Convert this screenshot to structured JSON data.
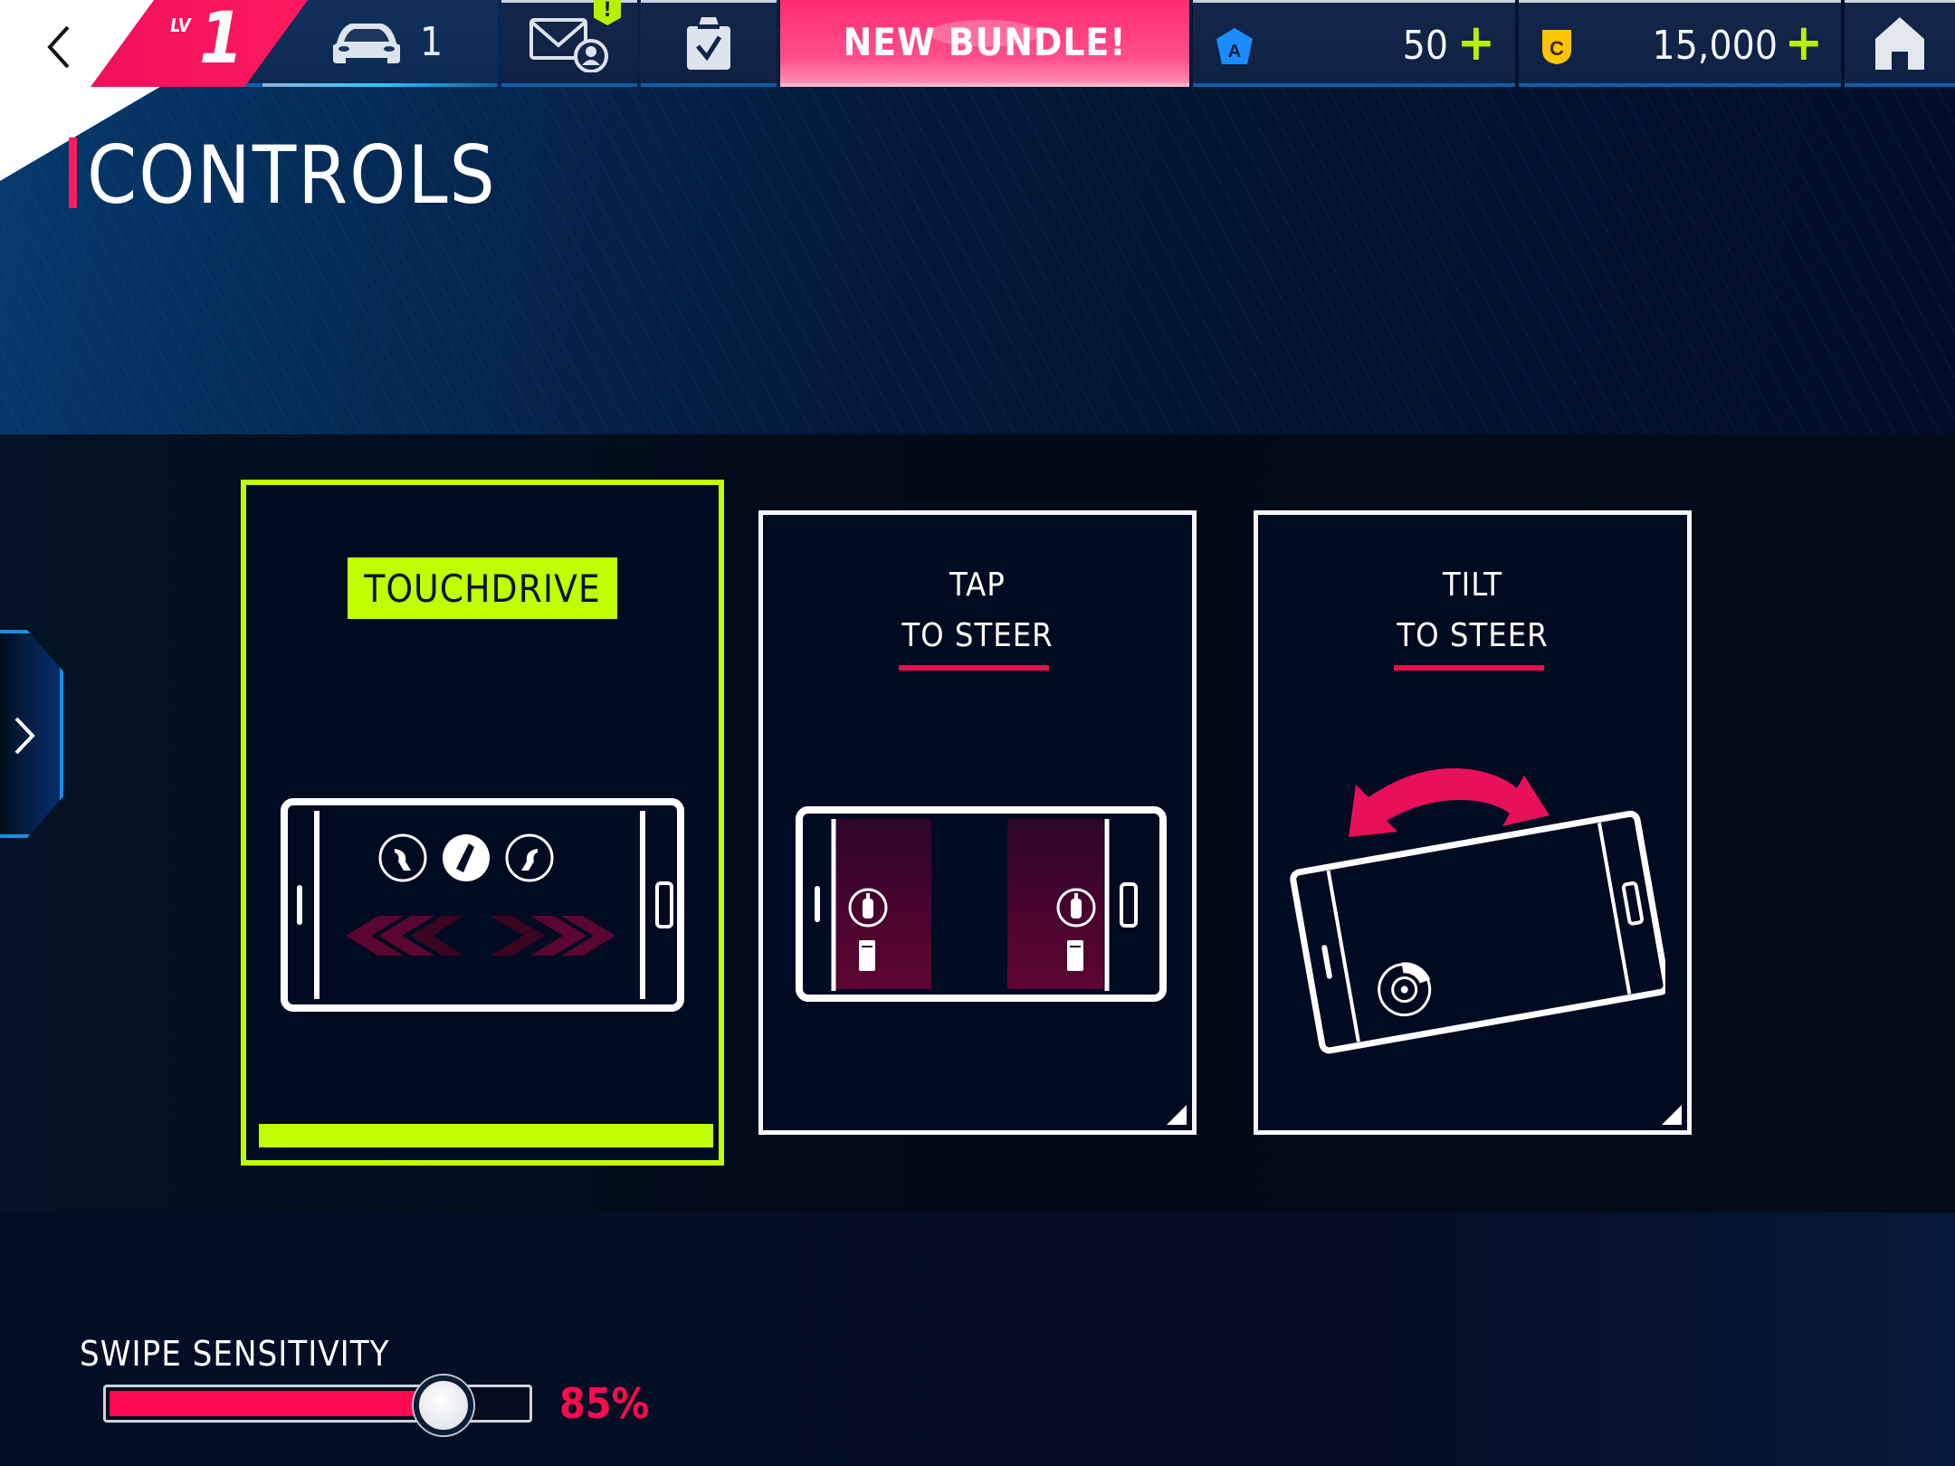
{
  "header": {
    "level_prefix": "LV",
    "level": "1",
    "garage_count": "1",
    "mail_notification": "!",
    "bundle_label": "NEW BUNDLE!",
    "tokens": "50",
    "credits": "15,000",
    "plus": "+"
  },
  "page": {
    "title": "CONTROLS"
  },
  "control_modes": [
    {
      "id": "touchdrive",
      "label": "TOUCHDRIVE",
      "selected": true
    },
    {
      "id": "tap",
      "line1": "TAP",
      "line2": "TO STEER",
      "selected": false
    },
    {
      "id": "tilt",
      "line1": "TILT",
      "line2": "TO STEER",
      "selected": false
    }
  ],
  "swipe_sensitivity": {
    "label": "SWIPE SENSITIVITY",
    "value_percent": 85,
    "value_text": "85%"
  },
  "colors": {
    "accent_pink": "#ff0a50",
    "accent_lime": "#bfff00",
    "token_blue": "#1a8cff",
    "credit_yellow": "#ffc400"
  }
}
